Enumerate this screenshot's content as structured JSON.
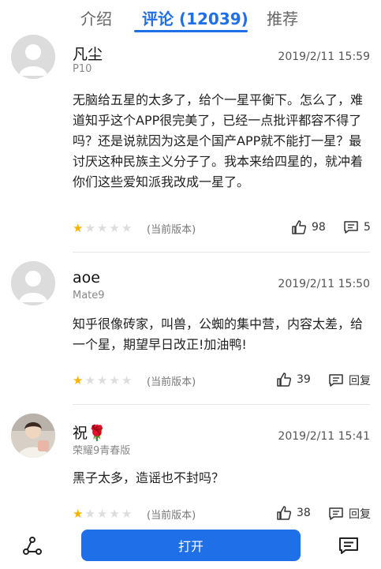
{
  "tabs": [
    {
      "label": "介绍",
      "active": false
    },
    {
      "label": "评论 (12039)",
      "active": true
    },
    {
      "label": "推荐",
      "active": false
    }
  ],
  "reviews": [
    {
      "username": "凡尘",
      "device": "P10",
      "date": "2019/2/11 15:59",
      "content": "无脑给五星的太多了，给个一星平衡下。怎么了，难道知乎这个APP很完美了，已经一点批评都容不得了吗？还是说就因为这是个国产APP就不能打一星？最讨厌这种民族主义分子了。我本来给四星的，就冲着你们这些爱知派我改成一星了。",
      "rating": 1,
      "version": "(当前版本)",
      "likes": "98",
      "reply": "5"
    },
    {
      "username": "aoe",
      "device": "Mate9",
      "date": "2019/2/11 15:50",
      "content": "知乎很像砖家，叫兽，公蜘的集中营，内容太差，给一个星，期望早日改正!加油鸭!",
      "rating": 1,
      "version": "(当前版本)",
      "likes": "39",
      "reply": "回复"
    },
    {
      "username": "祝🌹",
      "device": "荣耀9青春版",
      "date": "2019/2/11 15:41",
      "content": "黑子太多，造谣也不封吗？",
      "rating": 1,
      "version": "(当前版本)",
      "likes": "38",
      "reply": "回复"
    }
  ],
  "bottom": {
    "open_label": "打开"
  },
  "colors": {
    "accent": "#1e6fe8",
    "star_on": "#f5b400",
    "star_off": "#dddddd"
  },
  "icons": [
    "share-icon",
    "thumbs-up-icon",
    "comment-icon",
    "compose-comment-icon",
    "star-icon"
  ]
}
